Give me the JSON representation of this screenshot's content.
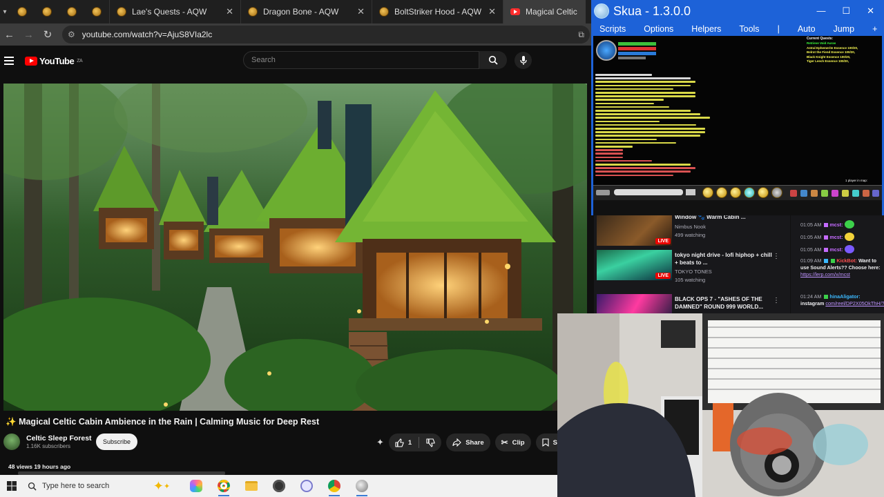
{
  "browser": {
    "tabs": [
      {
        "title": "Lae's Quests - AQW"
      },
      {
        "title": "Dragon Bone - AQW"
      },
      {
        "title": "BoltStriker Hood - AQW"
      },
      {
        "title": "Magical Celtic Ca"
      }
    ],
    "url": "youtube.com/watch?v=AjuS8VIa2lc"
  },
  "youtube": {
    "logo": "YouTube",
    "region": "ZA",
    "search_placeholder": "Search",
    "video_title": "Magical Celtic Cabin Ambience in the Rain | Calming Music for Deep Rest",
    "title_prefix": "✨",
    "channel_name": "Celtic Sleep Forest",
    "subscribers": "1.16K subscribers",
    "subscribe_label": "Subscribe",
    "likes": "1",
    "share_label": "Share",
    "clip_label": "Clip",
    "save_label": "Sav",
    "meta": "48 views  19 hours ago"
  },
  "taskbar": {
    "search_placeholder": "Type here to search"
  },
  "skua": {
    "title": "Skua - 1.3.0.0",
    "menu": [
      "Scripts",
      "Options",
      "Helpers",
      "Tools"
    ],
    "separator": "|",
    "right_menu": [
      "Auto",
      "Jump"
    ],
    "plus": "+",
    "quest_title": "Current Quests:",
    "quest_lines": [
      {
        "text": "Retrieve Void Auras",
        "color": "#3cff3c"
      },
      {
        "text": "Astral Ephemerite Essence 100/20,",
        "color": "#ffff55"
      },
      {
        "text": "Belrot the Fiend Essence 100/20,",
        "color": "#ffff55"
      },
      {
        "text": "Black Knight Essence 100/20,",
        "color": "#ffff55"
      },
      {
        "text": "Tiger Leech Essence 100/20,",
        "color": "#ffff55"
      }
    ],
    "player_count": "1 player in map:"
  },
  "twitch": {
    "recommended": [
      {
        "title": "Window 🐾 Warm Cabin ...",
        "channel": "Nimbus Nook",
        "viewers": "499 watching",
        "live": "LIVE"
      },
      {
        "title": "tokyo night drive - lofi hiphop + chill + beats to ...",
        "channel": "TOKYO TONES",
        "viewers": "105 watching",
        "live": "LIVE"
      },
      {
        "title": "BLACK OPS 7 - \"ASHES OF THE DAMNED\" ROUND 999 WORLD...",
        "channel": "",
        "viewers": "",
        "live": ""
      }
    ],
    "chat": [
      {
        "time": "01:05 AM",
        "user": "mcst:",
        "msg": "",
        "ucolor": "#c56bff"
      },
      {
        "time": "01:05 AM",
        "user": "mcst:",
        "msg": "",
        "ucolor": "#c56bff"
      },
      {
        "time": "01:05 AM",
        "user": "mcst:",
        "msg": "",
        "ucolor": "#c56bff"
      },
      {
        "time": "01:09 AM",
        "user": "KickBot:",
        "msg": "Want to use Sound Alerts?? Choose here:",
        "link": "https://lerp.com/x/mcst",
        "ucolor": "#ff4f4f"
      },
      {
        "time": "01:24 AM",
        "user": "hinaAligator:",
        "msg": "instagram",
        "link": "com/reel/DP2X05OkThH/?",
        "ucolor": "#3cb9ff"
      }
    ]
  }
}
